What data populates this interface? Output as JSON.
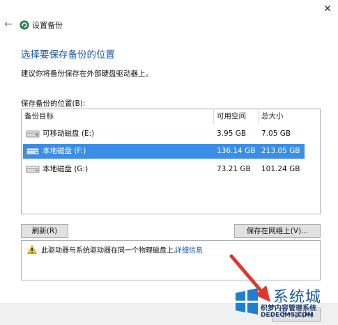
{
  "window": {
    "title": "设置备份",
    "close_glyph": "✕",
    "back_glyph": "←",
    "icons": {
      "back": "back-arrow-icon",
      "app": "backup-icon",
      "close": "close-icon"
    }
  },
  "heading": "选择要保存备份的位置",
  "description": "建议你将备份保存在外部硬盘驱动器上。",
  "location_label": "保存备份的位置(B):",
  "list": {
    "columns": {
      "target": "备份目标",
      "free": "可用空间",
      "total": "总大小"
    },
    "rows": [
      {
        "name": "可移动磁盘 (E:)",
        "free": "3.95 GB",
        "total": "7.05 GB",
        "selected": false,
        "icon": "removable-drive-icon"
      },
      {
        "name": "本地磁盘 (F:)",
        "free": "136.14 GB",
        "total": "213.05 GB",
        "selected": true,
        "icon": "local-disk-icon"
      },
      {
        "name": "本地磁盘 (G:)",
        "free": "73.21 GB",
        "total": "101.24 GB",
        "selected": false,
        "icon": "local-disk-icon"
      }
    ]
  },
  "buttons": {
    "refresh": "刷新(R)",
    "save_network": "保存在网络上(V)...",
    "next": "下一步(N)"
  },
  "warning": {
    "icon": "warning-icon",
    "text": "此驱动器与系统驱动器在同一个物理磁盘上。",
    "link": "详细信息"
  },
  "colors": {
    "heading": "#1a56a6",
    "selection": "#3a8ee6",
    "arrow": "#e2352e"
  },
  "watermark": {
    "main": "系统城",
    "line1": "织梦内容管理系统",
    "line2": "DEDECMS.COM"
  }
}
